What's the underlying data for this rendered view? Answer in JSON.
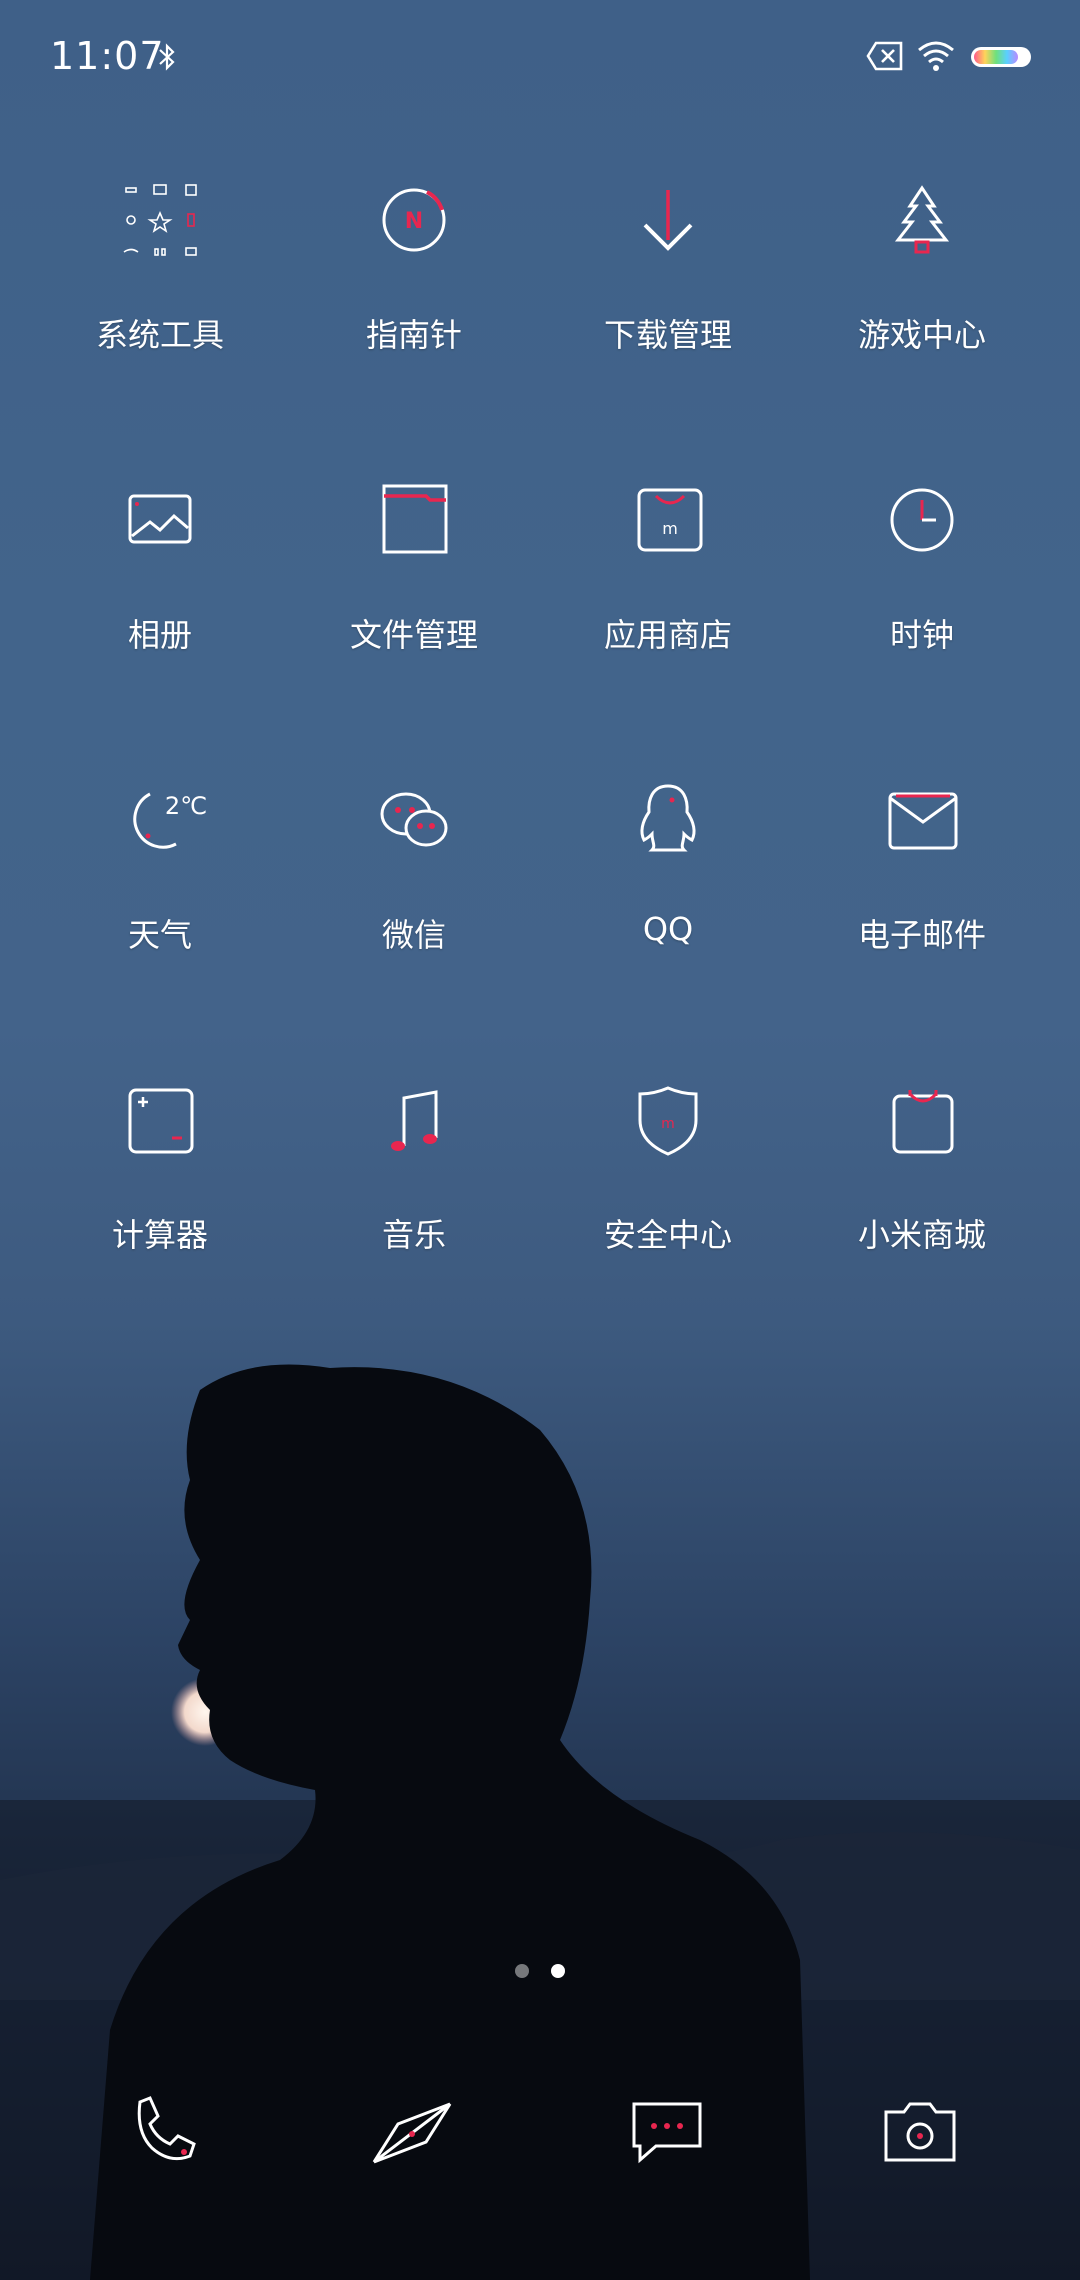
{
  "status_bar": {
    "time": "11:07",
    "icons": [
      "bluetooth-icon",
      "sim-missing-icon",
      "wifi-icon",
      "battery-icon"
    ]
  },
  "accent_color": "#e8264f",
  "apps": [
    {
      "label": "系统工具",
      "icon": "folder-icon"
    },
    {
      "label": "指南针",
      "icon": "compass-icon"
    },
    {
      "label": "下载管理",
      "icon": "download-icon"
    },
    {
      "label": "游戏中心",
      "icon": "game-center-icon"
    },
    {
      "label": "相册",
      "icon": "gallery-icon"
    },
    {
      "label": "文件管理",
      "icon": "file-manager-icon"
    },
    {
      "label": "应用商店",
      "icon": "app-store-icon"
    },
    {
      "label": "时钟",
      "icon": "clock-icon"
    },
    {
      "label": "天气",
      "icon": "weather-icon",
      "badge": "2℃"
    },
    {
      "label": "微信",
      "icon": "wechat-icon"
    },
    {
      "label": "QQ",
      "icon": "qq-icon"
    },
    {
      "label": "电子邮件",
      "icon": "email-icon"
    },
    {
      "label": "计算器",
      "icon": "calculator-icon"
    },
    {
      "label": "音乐",
      "icon": "music-icon"
    },
    {
      "label": "安全中心",
      "icon": "security-icon"
    },
    {
      "label": "小米商城",
      "icon": "mi-store-icon"
    }
  ],
  "page_indicator": {
    "pages": 2,
    "current": 2
  },
  "dock": [
    "phone-icon",
    "browser-icon",
    "messages-icon",
    "camera-icon"
  ]
}
